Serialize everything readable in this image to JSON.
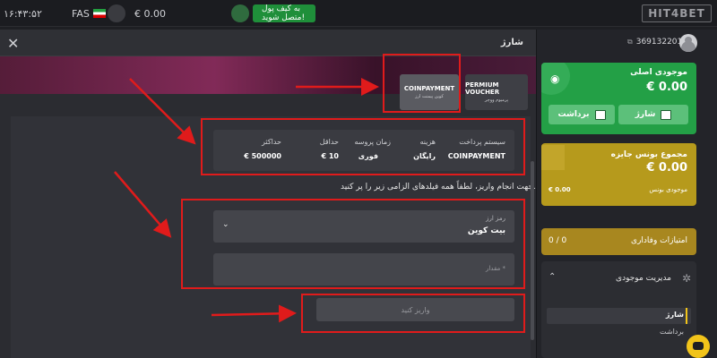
{
  "topbar": {
    "time": "۱۶:۴۳:۵۲",
    "language": "FAS",
    "balance": "€ 0.00",
    "wallet_notice": "به کیف پول متصل شوید!",
    "logo": "HIT4BET"
  },
  "modal": {
    "title": "شارژ",
    "methods": [
      {
        "label": "PERMIUM VOUCHER",
        "sub": "پرمیوم ووچر"
      },
      {
        "label": "COINPAYMENT",
        "sub": "کوین پیمنت ارز"
      }
    ],
    "table": {
      "headers": [
        "سیستم پرداخت",
        "هزینه",
        "زمان پروسه",
        "حداقل",
        "حداکثر"
      ],
      "values": [
        "COINPAYMENT",
        "رایگان",
        "فوری",
        "€ 10",
        "€ 500000"
      ]
    },
    "instructions": "جهت انجام واریز، لطفاً همه فیلدهای الزامی زیر را پر کنید.",
    "currency_label": "رمز ارز",
    "currency_value": "بیت کوین",
    "amount_placeholder": "مقدار *",
    "deposit_button": "واریز کنید"
  },
  "sidebar": {
    "user_id": "369132201",
    "main_balance_title": "موجودی اصلی",
    "main_balance_value": "€ 0.00",
    "deposit_label": "شارژ",
    "withdraw_label": "برداشت",
    "bonus_title": "مجموع بونس جایزه",
    "bonus_value": "€ 0.00",
    "bonus_balance_label": "موجودی بونس",
    "bonus_balance_value": "€ 0.00",
    "loyalty_label": "امتیازات وفاداری",
    "loyalty_value": "0 / 0",
    "wallet_management": "مدیریت موجودی",
    "menu_items": [
      "شارژ",
      "برداشت"
    ]
  },
  "colors": {
    "accent_green": "#23a046",
    "bonus_gold": "#b69a1c",
    "annotation_red": "#e01b1b"
  }
}
